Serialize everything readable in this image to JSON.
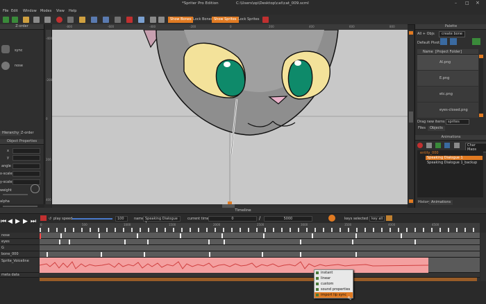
{
  "window": {
    "title": "*Spriter Pro Edition",
    "file_path": "C:\\Users\\op\\Desktop\\cat\\cat_009.scml"
  },
  "menu": [
    "File",
    "Edit",
    "Window",
    "Modes",
    "View",
    "Help"
  ],
  "toolbar": {
    "show_bones": "Show Bones",
    "lock_bones": "Lock Bones",
    "show_sprites": "Show Sprites",
    "lock_sprites": "Lock Sprites"
  },
  "ruler": {
    "h_ticks": [
      "-800",
      "-600",
      "-400",
      "-200",
      "0",
      "200",
      "400",
      "600",
      "800"
    ],
    "v_ticks": [
      "-400",
      "-200",
      "0",
      "200",
      "400"
    ]
  },
  "left_panel": {
    "z_order_tab": "Z-order",
    "items": [
      "sync",
      "nose"
    ],
    "tabs": [
      "Hierarchy",
      "Z-order"
    ],
    "object_properties_title": "Object Properties",
    "prop_labels": [
      "x",
      "y",
      "angle",
      "x-scale",
      "y-scale",
      "weight",
      "alpha"
    ]
  },
  "palette": {
    "title": "Palette",
    "all_label": "All + Objs",
    "create_bone": "create bone",
    "default_pivot": "Default Pivot:",
    "header_name": "Name",
    "header_folder": "[Project Folder]",
    "files": [
      "AI.png",
      "E.png",
      "etc.png",
      "eyes-closed.png"
    ],
    "drag_label": "Drag new items as:",
    "drag_value": "sprites",
    "tabs": [
      "Files",
      "Objects"
    ]
  },
  "animations": {
    "title": "Animations",
    "char_maps": "Char Maps",
    "entity": "entity_000",
    "items": [
      "Speaking Dialogue 1",
      "Speaking Dialogue 1_backup"
    ],
    "tabs": [
      "History",
      "Animations"
    ]
  },
  "timeline": {
    "title": "Timeline",
    "play_speed_label": "play speed",
    "play_speed_value": "100",
    "name_label": "name",
    "name_value": "Speaking Dialogue 1",
    "current_time_label": "current time",
    "current_time_value": "0",
    "slash": "/",
    "total_time": "5000",
    "keys_selected": "keys selected",
    "key_all": "key all",
    "ticks": [
      "0",
      "500",
      "1000",
      "1500",
      "2000",
      "2500",
      "3000",
      "3500",
      "4000",
      "4500"
    ],
    "tracks": [
      "nose",
      "eyes",
      "G",
      "bone_000",
      "Sprite_Voiceline"
    ],
    "meta_data": "meta data"
  },
  "context_menu": {
    "items": [
      "instant",
      "linear",
      "custom",
      "sound properties",
      "import lip sync"
    ],
    "highlighted": "import lip sync"
  },
  "colors": {
    "accent": "#e07a22",
    "canvas": "#c8c8c8",
    "eye_green": "#0e8a6a",
    "eye_yellow": "#f3e29a",
    "waveform": "#f4a0a0"
  }
}
